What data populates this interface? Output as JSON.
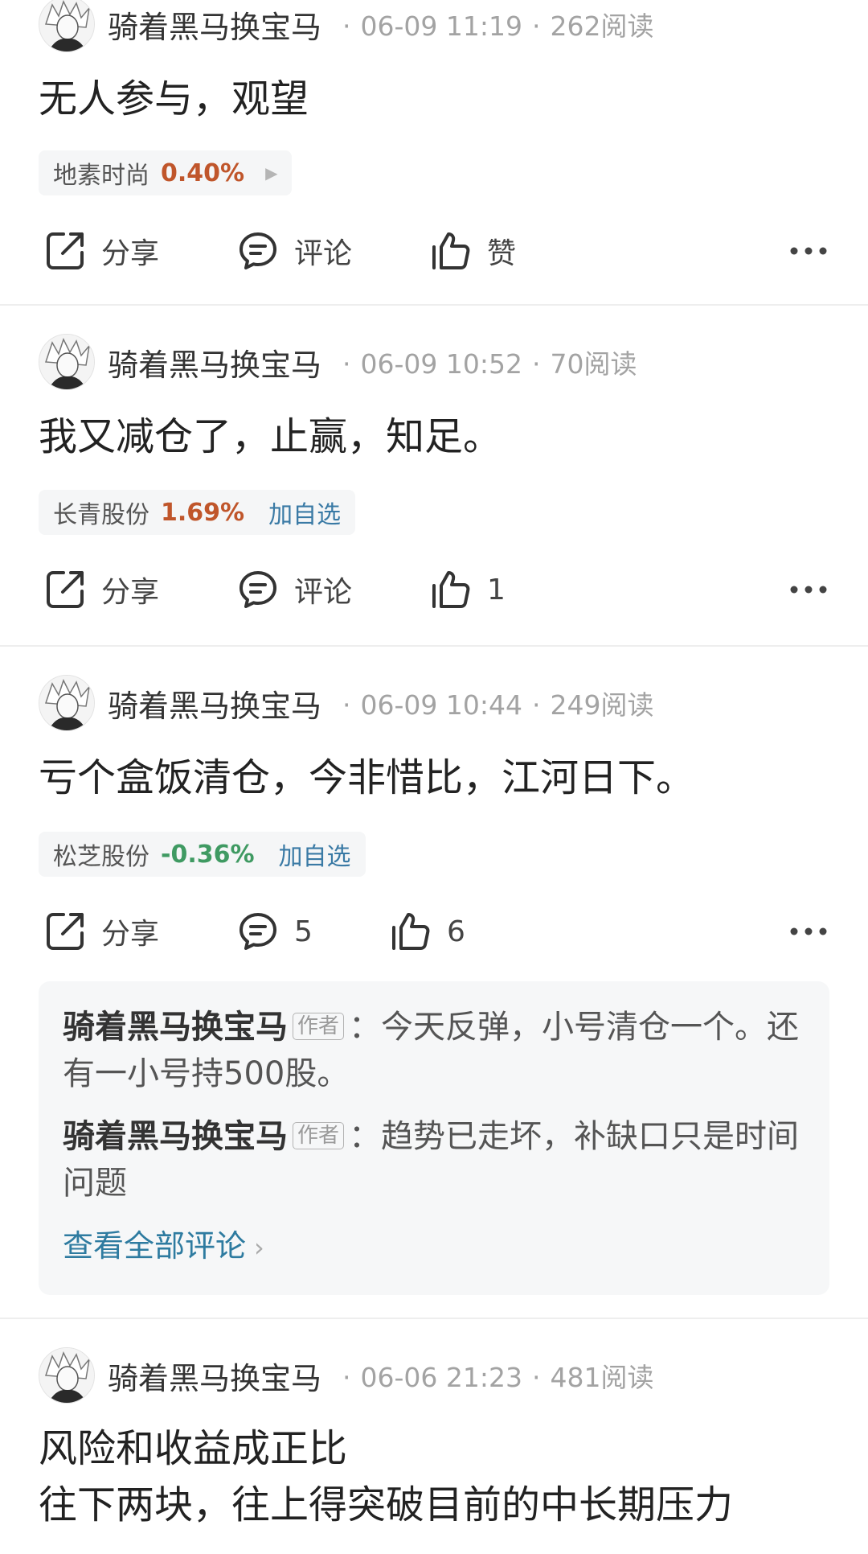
{
  "posts": [
    {
      "author": "骑着黑马换宝马",
      "time": "06-09 11:19",
      "reads": "262阅读",
      "content": "无人参与，观望",
      "stock": {
        "name": "地素时尚",
        "change": "0.40%",
        "direction": "up"
      },
      "share": "分享",
      "comment": "评论",
      "like": "赞"
    },
    {
      "author": "骑着黑马换宝马",
      "time": "06-09 10:52",
      "reads": "70阅读",
      "content": "我又减仓了，止赢，知足。",
      "stock": {
        "name": "长青股份",
        "change": "1.69%",
        "direction": "up",
        "add_label": "加自选"
      },
      "share": "分享",
      "comment": "评论",
      "like": "1"
    },
    {
      "author": "骑着黑马换宝马",
      "time": "06-09 10:44",
      "reads": "249阅读",
      "content": "亏个盒饭清仓，今非惜比，江河日下。",
      "stock": {
        "name": "松芝股份",
        "change": "-0.36%",
        "direction": "down",
        "add_label": "加自选"
      },
      "share": "分享",
      "comment": "5",
      "like": "6",
      "comments": [
        {
          "author": "骑着黑马换宝马",
          "badge": "作者",
          "text": "今天反弹，小号清仓一个。还有一小号持500股。"
        },
        {
          "author": "骑着黑马换宝马",
          "badge": "作者",
          "text": "趋势已走坏，补缺口只是时间问题"
        }
      ],
      "view_all": "查看全部评论"
    },
    {
      "author": "骑着黑马换宝马",
      "time": "06-06 21:23",
      "reads": "481阅读",
      "content": "风险和收益成正比\n往下两块，往上得突破目前的中长期压力"
    }
  ],
  "colors": {
    "up": "#c0562b",
    "down": "#3f9a62",
    "link": "#3a7aa5"
  },
  "icons": {
    "share": "share-icon",
    "comment": "comment-icon",
    "like": "thumbs-up-icon",
    "more": "more-icon"
  }
}
